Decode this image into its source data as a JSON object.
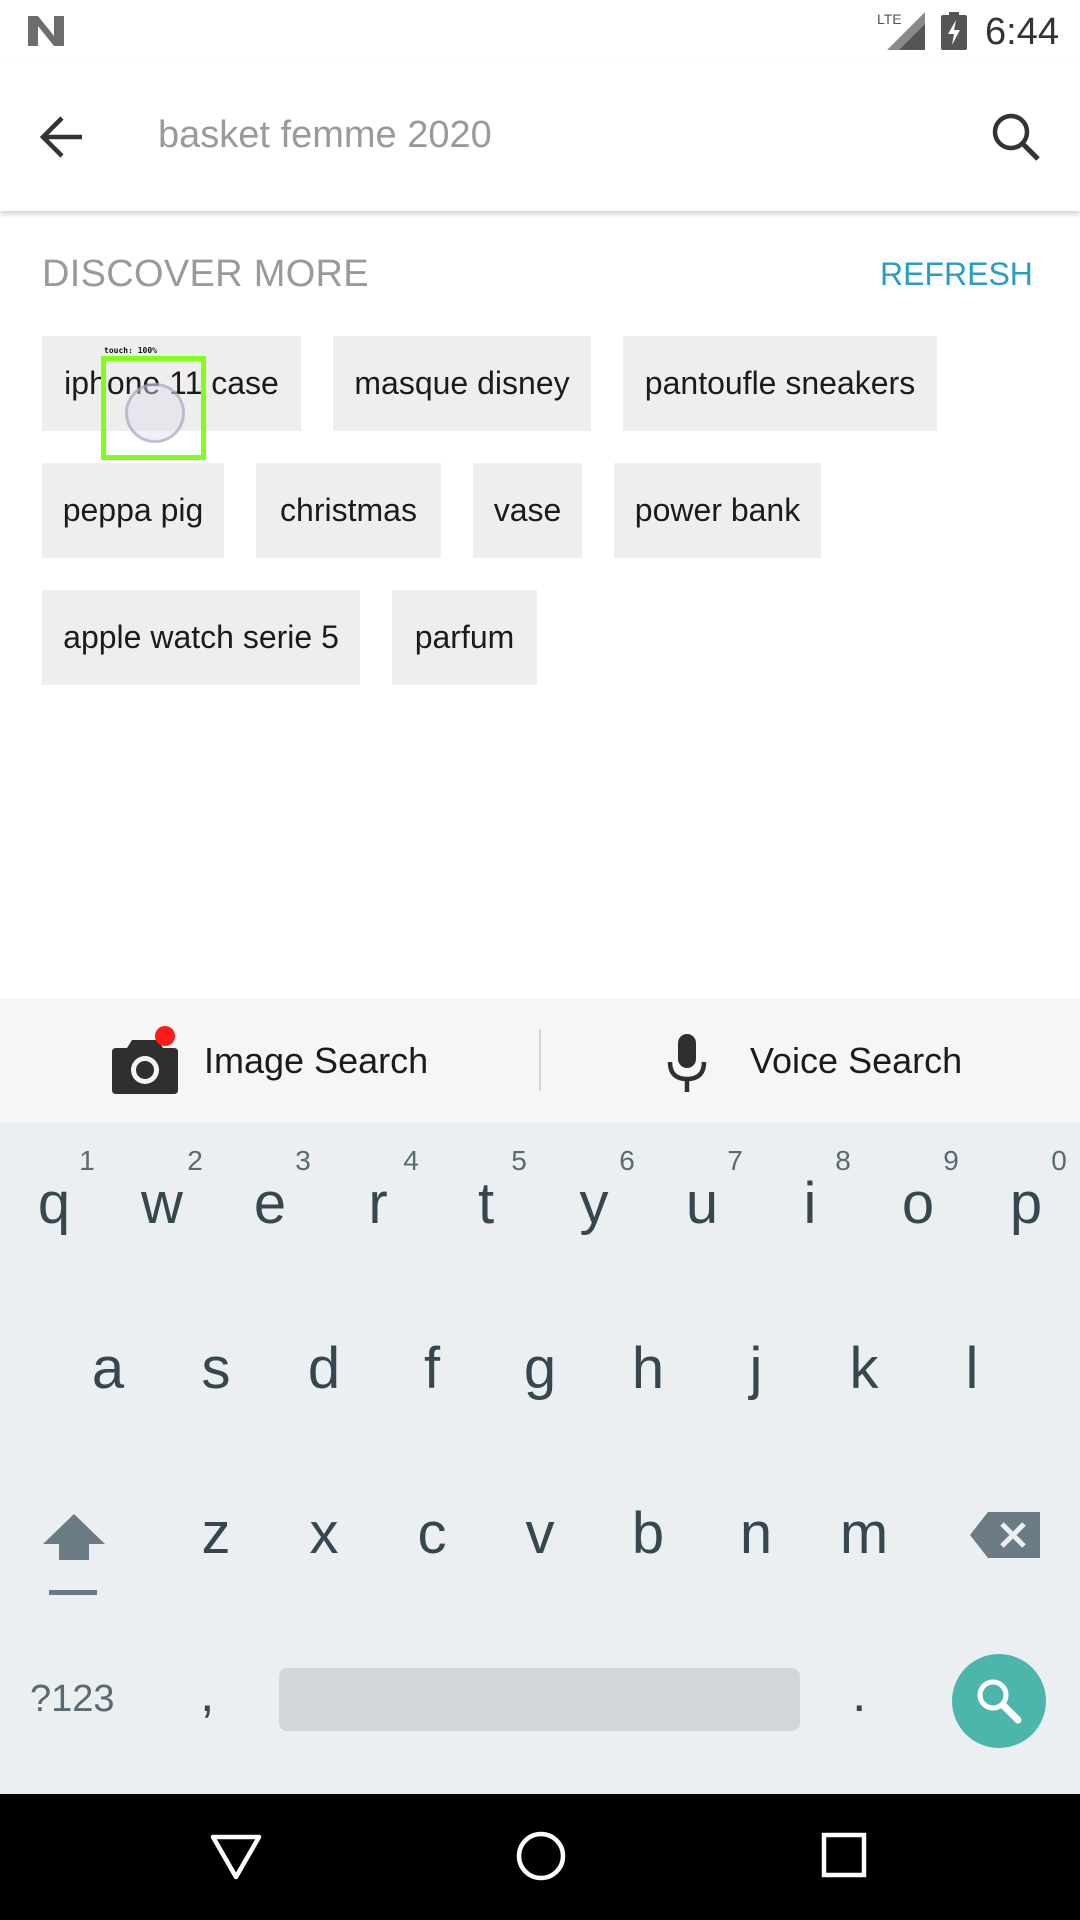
{
  "status_bar": {
    "time": "6:44",
    "network": "LTE",
    "icons": [
      "n-logo-icon",
      "signal-icon",
      "battery-charging-icon"
    ]
  },
  "search": {
    "query": "basket femme 2020",
    "back_icon": "arrow-left-icon",
    "search_icon": "search-icon"
  },
  "discover": {
    "title": "DISCOVER MORE",
    "refresh_label": "REFRESH",
    "accent_color": "#2b9dc2",
    "chips": [
      "iphone 11 case",
      "masque disney",
      "pantoufle sneakers",
      "peppa pig",
      "christmas",
      "vase",
      "power bank",
      "apple watch serie 5",
      "parfum"
    ]
  },
  "touch_indicator": {
    "label": "touch: 100%"
  },
  "search_options": {
    "image_search_label": "Image Search",
    "voice_search_label": "Voice Search",
    "image_icon": "camera-icon",
    "voice_icon": "microphone-icon",
    "notification_dot_color": "#ff1a1a"
  },
  "keyboard": {
    "row1": [
      "q",
      "w",
      "e",
      "r",
      "t",
      "y",
      "u",
      "i",
      "o",
      "p"
    ],
    "row1_hints": [
      "1",
      "2",
      "3",
      "4",
      "5",
      "6",
      "7",
      "8",
      "9",
      "0"
    ],
    "row2": [
      "a",
      "s",
      "d",
      "f",
      "g",
      "h",
      "j",
      "k",
      "l"
    ],
    "row3": [
      "z",
      "x",
      "c",
      "v",
      "b",
      "n",
      "m"
    ],
    "symbols_label": "?123",
    "comma": ",",
    "period": ".",
    "action_color": "#4db6ac",
    "shift_icon": "shift-icon",
    "backspace_icon": "backspace-icon",
    "action_icon": "search-icon"
  },
  "nav_bar": {
    "icons": [
      "back-triangle-icon",
      "home-circle-icon",
      "recents-square-icon"
    ]
  }
}
